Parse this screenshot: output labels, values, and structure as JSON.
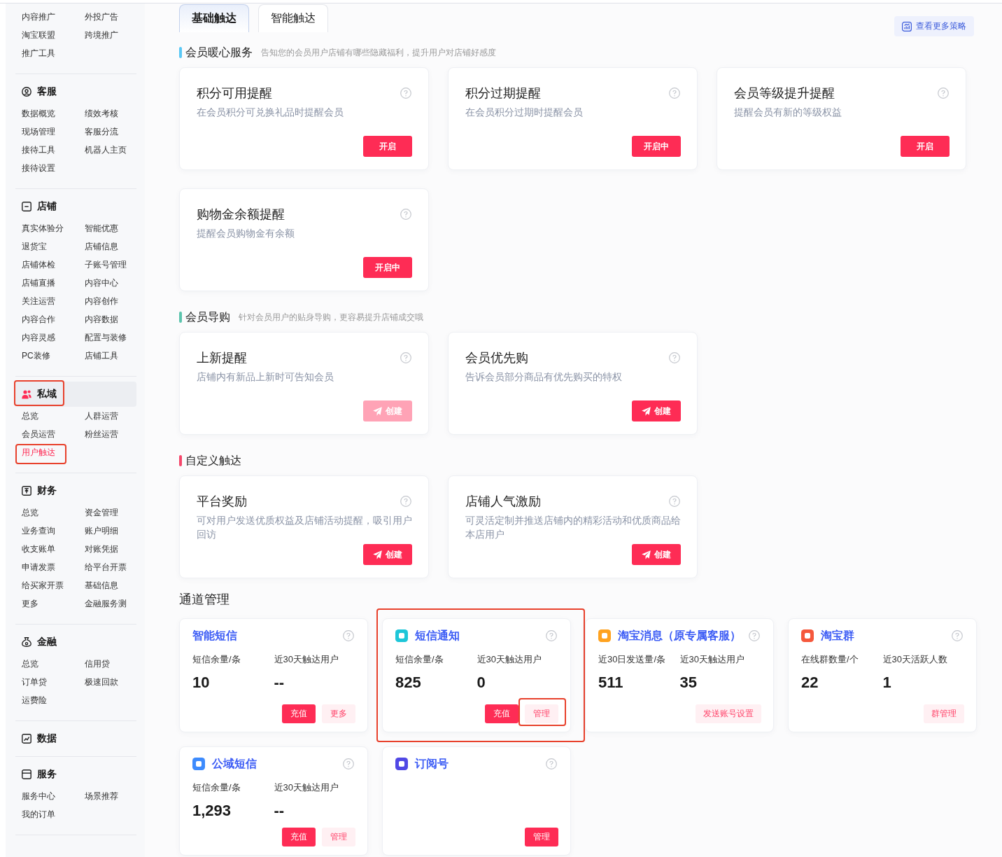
{
  "sidebar": {
    "groups": [
      {
        "items": [
          {
            "label": "内容推广",
            "selected": false,
            "highlighted": false
          },
          {
            "label": "外投广告",
            "selected": false,
            "highlighted": false
          },
          {
            "label": "淘宝联盟",
            "selected": false,
            "highlighted": false
          },
          {
            "label": "跨境推广",
            "selected": false,
            "highlighted": false
          },
          {
            "label": "推广工具",
            "selected": false,
            "highlighted": false
          }
        ]
      },
      {
        "title": "客服",
        "selected": false,
        "highlighted": false,
        "items": [
          {
            "label": "数据概览",
            "selected": false,
            "highlighted": false
          },
          {
            "label": "绩效考核",
            "selected": false,
            "highlighted": false
          },
          {
            "label": "现场管理",
            "selected": false,
            "highlighted": false
          },
          {
            "label": "客服分流",
            "selected": false,
            "highlighted": false
          },
          {
            "label": "接待工具",
            "selected": false,
            "highlighted": false
          },
          {
            "label": "机器人主页",
            "selected": false,
            "highlighted": false
          },
          {
            "label": "接待设置",
            "selected": false,
            "highlighted": false
          }
        ]
      },
      {
        "title": "店铺",
        "selected": false,
        "highlighted": false,
        "items": [
          {
            "label": "真实体验分",
            "selected": false,
            "highlighted": false
          },
          {
            "label": "智能优惠",
            "selected": false,
            "highlighted": false
          },
          {
            "label": "退货宝",
            "selected": false,
            "highlighted": false
          },
          {
            "label": "店铺信息",
            "selected": false,
            "highlighted": false
          },
          {
            "label": "店铺体检",
            "selected": false,
            "highlighted": false
          },
          {
            "label": "子账号管理",
            "selected": false,
            "highlighted": false
          },
          {
            "label": "店铺直播",
            "selected": false,
            "highlighted": false
          },
          {
            "label": "内容中心",
            "selected": false,
            "highlighted": false
          },
          {
            "label": "关注运营",
            "selected": false,
            "highlighted": false
          },
          {
            "label": "内容创作",
            "selected": false,
            "highlighted": false
          },
          {
            "label": "内容合作",
            "selected": false,
            "highlighted": false
          },
          {
            "label": "内容数据",
            "selected": false,
            "highlighted": false
          },
          {
            "label": "内容灵感",
            "selected": false,
            "highlighted": false
          },
          {
            "label": "配置与装修",
            "selected": false,
            "highlighted": false
          },
          {
            "label": "PC装修",
            "selected": false,
            "highlighted": false
          },
          {
            "label": "店铺工具",
            "selected": false,
            "highlighted": false
          }
        ]
      },
      {
        "title": "私域",
        "selected": true,
        "highlighted": true,
        "items": [
          {
            "label": "总览",
            "selected": false,
            "highlighted": false
          },
          {
            "label": "人群运营",
            "selected": false,
            "highlighted": false
          },
          {
            "label": "会员运营",
            "selected": false,
            "highlighted": false
          },
          {
            "label": "粉丝运营",
            "selected": false,
            "highlighted": false
          },
          {
            "label": "用户触达",
            "selected": true,
            "highlighted": true
          }
        ]
      },
      {
        "title": "财务",
        "selected": false,
        "highlighted": false,
        "items": [
          {
            "label": "总览",
            "selected": false,
            "highlighted": false
          },
          {
            "label": "资金管理",
            "selected": false,
            "highlighted": false
          },
          {
            "label": "业务查询",
            "selected": false,
            "highlighted": false
          },
          {
            "label": "账户明细",
            "selected": false,
            "highlighted": false
          },
          {
            "label": "收支账单",
            "selected": false,
            "highlighted": false
          },
          {
            "label": "对账凭据",
            "selected": false,
            "highlighted": false
          },
          {
            "label": "申请发票",
            "selected": false,
            "highlighted": false
          },
          {
            "label": "给平台开票",
            "selected": false,
            "highlighted": false
          },
          {
            "label": "给买家开票",
            "selected": false,
            "highlighted": false
          },
          {
            "label": "基础信息",
            "selected": false,
            "highlighted": false
          },
          {
            "label": "更多",
            "selected": false,
            "highlighted": false
          },
          {
            "label": "金融服务测",
            "selected": false,
            "highlighted": false
          }
        ]
      },
      {
        "title": "金融",
        "selected": false,
        "highlighted": false,
        "items": [
          {
            "label": "总览",
            "selected": false,
            "highlighted": false
          },
          {
            "label": "信用贷",
            "selected": false,
            "highlighted": false
          },
          {
            "label": "订单贷",
            "selected": false,
            "highlighted": false
          },
          {
            "label": "极速回款",
            "selected": false,
            "highlighted": false
          },
          {
            "label": "运费险",
            "selected": false,
            "highlighted": false
          }
        ]
      },
      {
        "title": "数据",
        "selected": false,
        "highlighted": false
      },
      {
        "title": "服务",
        "selected": false,
        "highlighted": false,
        "items": [
          {
            "label": "服务中心",
            "selected": false,
            "highlighted": false
          },
          {
            "label": "场景推荐",
            "selected": false,
            "highlighted": false
          },
          {
            "label": "我的订单",
            "selected": false,
            "highlighted": false
          }
        ]
      }
    ]
  },
  "tabs": [
    {
      "label": "基础触达",
      "selected": true
    },
    {
      "label": "智能触达",
      "selected": false
    }
  ],
  "strategy_button": {
    "label": "查看更多策略"
  },
  "sections": [
    {
      "title": "会员暖心服务",
      "subtitle": "告知您的会员用户店铺有哪些隐藏福利，提升用户对店铺好感度",
      "color": "#5ac8f5",
      "cards": [
        {
          "title": "积分可用提醒",
          "description": "在会员积分可兑换礼品时提醒会员",
          "button": {
            "label": "开启",
            "kind": "plain",
            "disabled": false
          }
        },
        {
          "title": "积分过期提醒",
          "description": "在会员积分过期时提醒会员",
          "button": {
            "label": "开启中",
            "kind": "plain",
            "disabled": false
          }
        },
        {
          "title": "会员等级提升提醒",
          "description": "提醒会员有新的等级权益",
          "button": {
            "label": "开启",
            "kind": "plain",
            "disabled": false
          }
        },
        {
          "title": "购物金余额提醒",
          "description": "提醒会员购物金有余额",
          "button": {
            "label": "开启中",
            "kind": "plain",
            "disabled": false
          }
        }
      ]
    },
    {
      "title": "会员导购",
      "subtitle": "针对会员用户的贴身导购，更容易提升店铺成交哦",
      "color": "#5cc4ad",
      "cards": [
        {
          "title": "上新提醒",
          "description": "店铺内有新品上新时可告知会员",
          "button": {
            "label": "创建",
            "kind": "send",
            "disabled": true
          }
        },
        {
          "title": "会员优先购",
          "description": "告诉会员部分商品有优先购买的特权",
          "button": {
            "label": "创建",
            "kind": "send",
            "disabled": false
          }
        }
      ]
    },
    {
      "title": "自定义触达",
      "color": "#f5476b",
      "cards": [
        {
          "title": "平台奖励",
          "description": "可对用户发送优质权益及店铺活动提醒，吸引用户回访",
          "button": {
            "label": "创建",
            "kind": "send",
            "disabled": false
          }
        },
        {
          "title": "店铺人气激励",
          "description": "可灵活定制并推送店铺内的精彩活动和优质商品给本店用户",
          "button": {
            "label": "创建",
            "kind": "send",
            "disabled": false
          }
        }
      ]
    }
  ],
  "channels": {
    "title": "通道管理",
    "cards": [
      {
        "title": "智能短信",
        "highlighted": false,
        "stats": [
          {
            "label": "短信余量/条",
            "value": "10"
          },
          {
            "label": "近30天触达用户",
            "value": "--"
          }
        ],
        "buttons": [
          {
            "label": "充值",
            "kind": "primary",
            "highlighted": false
          },
          {
            "label": "更多",
            "kind": "secondary",
            "highlighted": false
          }
        ]
      },
      {
        "title": "短信通知",
        "color": "#1ec6d8",
        "highlighted": true,
        "stats": [
          {
            "label": "短信余量/条",
            "value": "825"
          },
          {
            "label": "近30天触达用户",
            "value": "0"
          }
        ],
        "buttons": [
          {
            "label": "充值",
            "kind": "primary",
            "highlighted": false
          },
          {
            "label": "管理",
            "kind": "secondary",
            "highlighted": true
          }
        ]
      },
      {
        "title": "淘宝消息（原专属客服）",
        "color": "#ffa21f",
        "highlighted": false,
        "stats": [
          {
            "label": "近30日发送量/条",
            "value": "511"
          },
          {
            "label": "近30天触达用户",
            "value": "35"
          }
        ],
        "buttons": [
          {
            "label": "发送账号设置",
            "kind": "secondary",
            "highlighted": false
          }
        ]
      },
      {
        "title": "淘宝群",
        "color": "#f5583c",
        "highlighted": false,
        "stats": [
          {
            "label": "在线群数量/个",
            "value": "22"
          },
          {
            "label": "近30天活跃人数",
            "value": "1"
          }
        ],
        "buttons": [
          {
            "label": "群管理",
            "kind": "secondary",
            "highlighted": false
          }
        ]
      },
      {
        "title": "公域短信",
        "color": "#3d8bfd",
        "highlighted": false,
        "stats": [
          {
            "label": "短信余量/条",
            "value": "1,293"
          },
          {
            "label": "近30天触达用户",
            "value": "--"
          }
        ],
        "buttons": [
          {
            "label": "充值",
            "kind": "primary",
            "highlighted": false
          },
          {
            "label": "管理",
            "kind": "secondary",
            "highlighted": false
          }
        ]
      },
      {
        "title": "订阅号",
        "color": "#5048e5",
        "highlighted": false,
        "buttons": [
          {
            "label": "管理",
            "kind": "primary",
            "highlighted": false
          }
        ]
      }
    ]
  }
}
